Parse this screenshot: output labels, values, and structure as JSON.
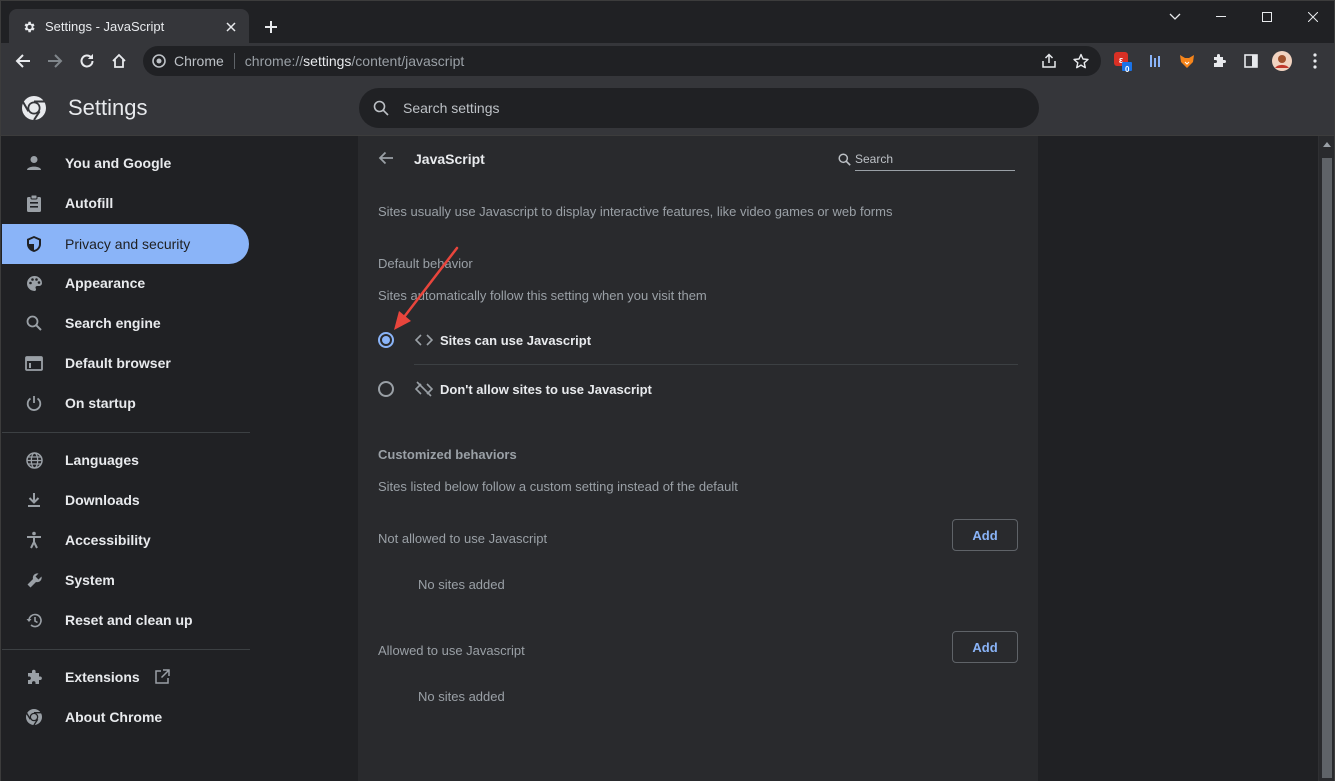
{
  "tab": {
    "title": "Settings - JavaScript"
  },
  "omnibox": {
    "site_label": "Chrome",
    "url_prefix": "chrome://",
    "url_host": "settings",
    "url_path": "/content/javascript"
  },
  "extensions": {
    "badge_count": "0"
  },
  "header": {
    "title": "Settings",
    "search_placeholder": "Search settings"
  },
  "sidebar": {
    "items": [
      {
        "label": "You and Google",
        "icon": "person-icon"
      },
      {
        "label": "Autofill",
        "icon": "clipboard-icon"
      },
      {
        "label": "Privacy and security",
        "icon": "shield-icon",
        "active": true
      },
      {
        "label": "Appearance",
        "icon": "palette-icon"
      },
      {
        "label": "Search engine",
        "icon": "search-icon"
      },
      {
        "label": "Default browser",
        "icon": "browser-icon"
      },
      {
        "label": "On startup",
        "icon": "power-icon"
      },
      {
        "label": "Languages",
        "icon": "globe-icon"
      },
      {
        "label": "Downloads",
        "icon": "download-icon"
      },
      {
        "label": "Accessibility",
        "icon": "accessibility-icon"
      },
      {
        "label": "System",
        "icon": "wrench-icon"
      },
      {
        "label": "Reset and clean up",
        "icon": "restore-icon"
      },
      {
        "label": "Extensions",
        "icon": "puzzle-icon"
      },
      {
        "label": "About Chrome",
        "icon": "chrome-logo-icon"
      }
    ]
  },
  "page": {
    "title": "JavaScript",
    "search_placeholder": "Search",
    "description": "Sites usually use Javascript to display interactive features, like video games or web forms",
    "default_behavior": {
      "title": "Default behavior",
      "subtitle": "Sites automatically follow this setting when you visit them",
      "options": [
        {
          "label": "Sites can use Javascript",
          "checked": true,
          "icon": "code-icon"
        },
        {
          "label": "Don't allow sites to use Javascript",
          "checked": false,
          "icon": "code-off-icon"
        }
      ]
    },
    "customized": {
      "title": "Customized behaviors",
      "subtitle": "Sites listed below follow a custom setting instead of the default",
      "not_allowed": {
        "label": "Not allowed to use Javascript",
        "button": "Add",
        "empty": "No sites added"
      },
      "allowed": {
        "label": "Allowed to use Javascript",
        "button": "Add",
        "empty": "No sites added"
      }
    }
  },
  "colors": {
    "accent": "#8ab4f8",
    "background": "#202124",
    "card": "#292a2d",
    "annotation_arrow": "#e8453c"
  }
}
